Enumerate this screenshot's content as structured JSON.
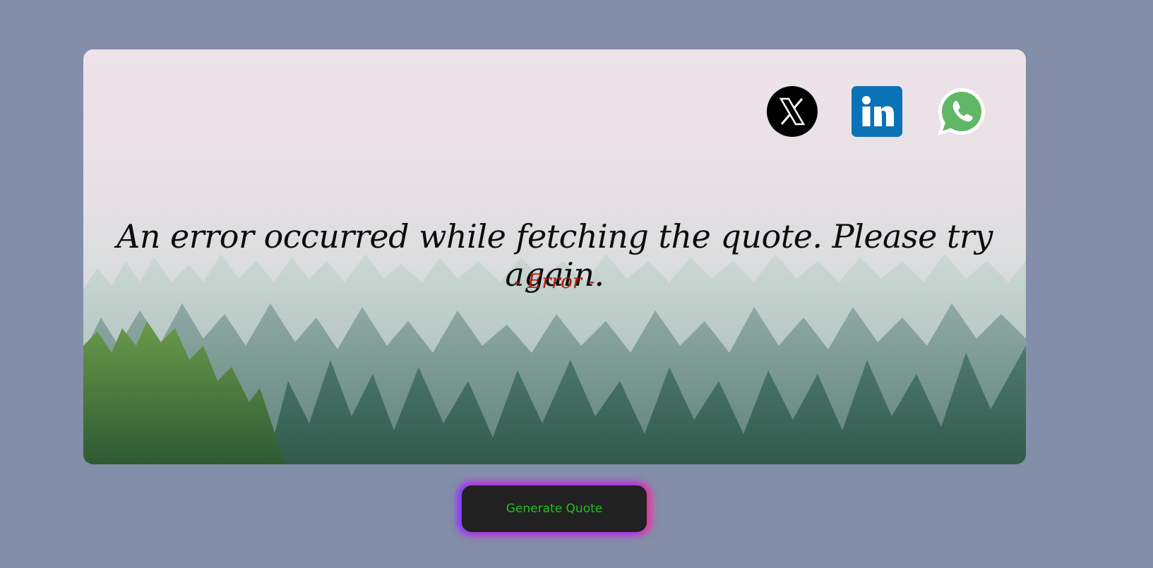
{
  "social": {
    "twitter_icon": "x-logo-icon",
    "linkedin_icon": "linkedin-logo-icon",
    "whatsapp_icon": "whatsapp-logo-icon"
  },
  "quote": {
    "text": "An error occurred while fetching the quote. Please try again.",
    "author": "- Error -"
  },
  "actions": {
    "generate_label": "Generate Quote"
  },
  "colors": {
    "page_bg": "#838ea8",
    "author": "#b0200f",
    "button_bg": "#212121",
    "button_text": "#1fc21f",
    "linkedin": "#0a72b6",
    "whatsapp": "#60b866"
  }
}
